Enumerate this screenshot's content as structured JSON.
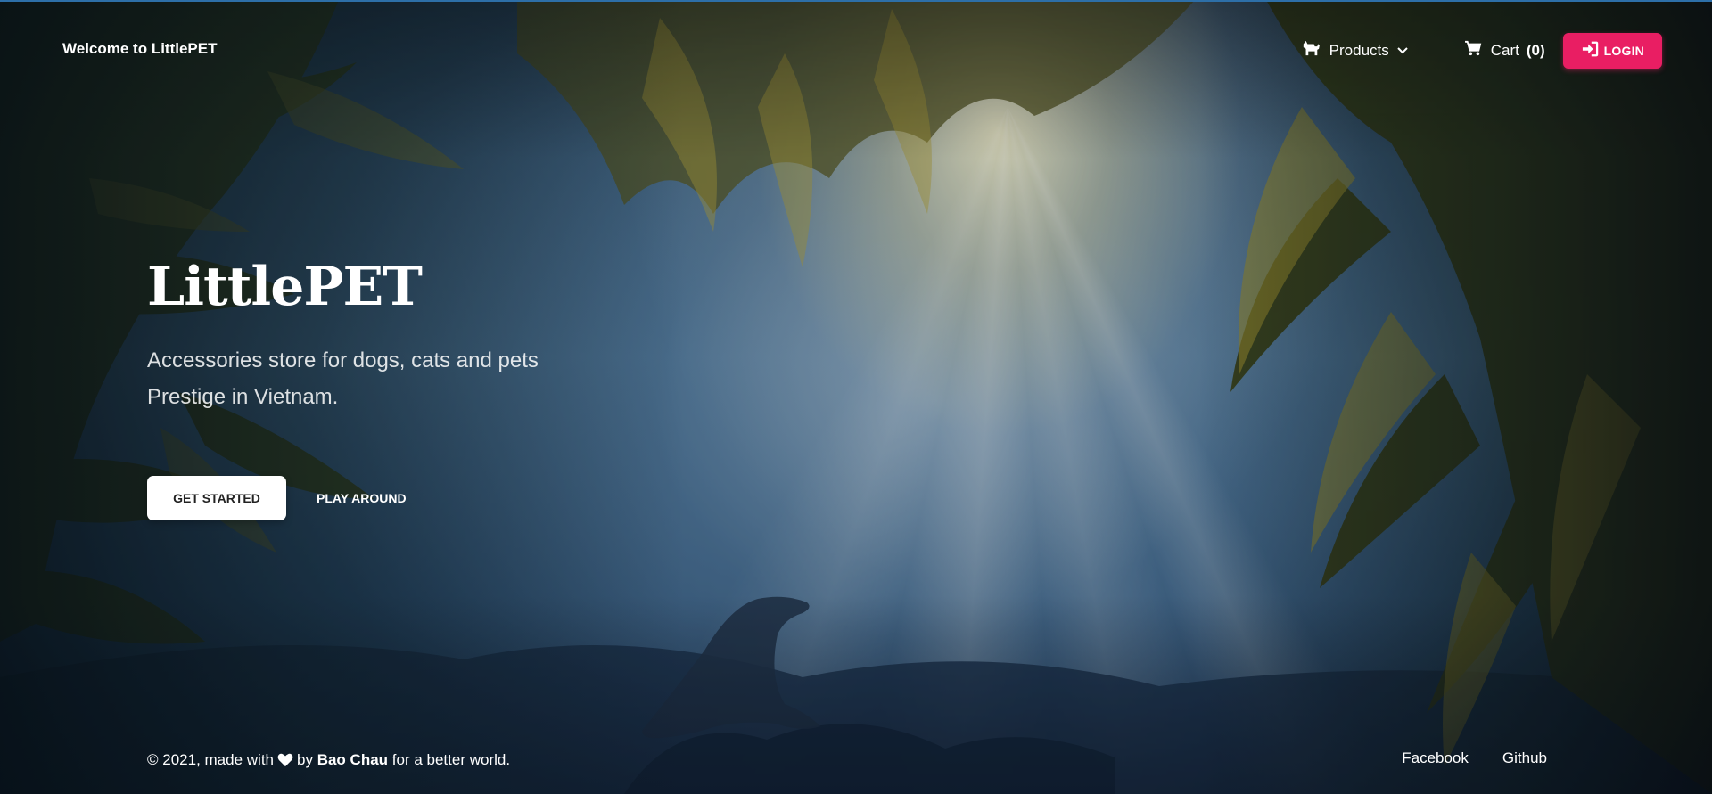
{
  "navbar": {
    "brand": "Welcome to LittlePET",
    "products_label": "Products",
    "cart_label": "Cart",
    "cart_count": "(0)",
    "login_label": "LOGIN"
  },
  "hero": {
    "title": "LittlePET",
    "subtitle": "Accessories store for dogs, cats and pets Prestige in Vietnam.",
    "get_started_label": "GET STARTED",
    "play_around_label": "PLAY AROUND"
  },
  "footer": {
    "copyright_prefix": "© 2021, made with",
    "copyright_by": "by",
    "author": "Bao Chau",
    "copyright_suffix": "for a better world.",
    "links": [
      "Facebook",
      "Github"
    ]
  },
  "icons": {
    "products": "dog-icon",
    "cart": "cart-icon",
    "login": "sign-in-icon",
    "heart": "heart-icon",
    "dropdown": "chevron-down-icon"
  },
  "colors": {
    "accent": "#e91e63",
    "text": "#ffffff",
    "button_light": "#ffffff"
  }
}
